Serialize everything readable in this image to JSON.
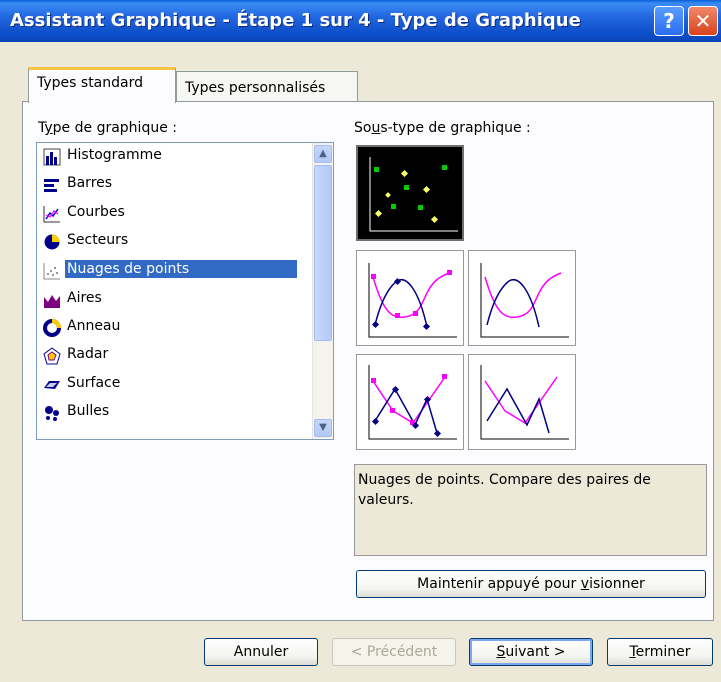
{
  "window": {
    "title": "Assistant Graphique - Étape 1 sur 4 - Type de Graphique",
    "help_label": "?",
    "close_label": "✕"
  },
  "tabs": [
    {
      "label": "Types standard",
      "active": true
    },
    {
      "label": "Types personnalisés",
      "active": false
    }
  ],
  "chart_type_list": {
    "label_prefix": "T",
    "label_accel": "y",
    "label_rest": "pe de graphique :",
    "items": [
      {
        "label": "Histogramme",
        "icon": "column-chart-icon"
      },
      {
        "label": "Barres",
        "icon": "bar-chart-icon"
      },
      {
        "label": "Courbes",
        "icon": "line-chart-icon"
      },
      {
        "label": "Secteurs",
        "icon": "pie-chart-icon"
      },
      {
        "label": "Nuages de points",
        "icon": "scatter-chart-icon",
        "selected": true
      },
      {
        "label": "Aires",
        "icon": "area-chart-icon"
      },
      {
        "label": "Anneau",
        "icon": "doughnut-chart-icon"
      },
      {
        "label": "Radar",
        "icon": "radar-chart-icon"
      },
      {
        "label": "Surface",
        "icon": "surface-chart-icon"
      },
      {
        "label": "Bulles",
        "icon": "bubble-chart-icon"
      }
    ],
    "scroll_up": "▲",
    "scroll_down": "▼"
  },
  "subtype": {
    "label_prefix": "So",
    "label_accel": "u",
    "label_rest": "s-type de graphique :",
    "thumbnails": [
      "scatter-markers-only",
      "scatter-smooth-lines-markers",
      "scatter-smooth-lines",
      "scatter-straight-lines-markers",
      "scatter-straight-lines"
    ]
  },
  "description": "Nuages de points. Compare des paires de valeurs.",
  "preview_button": {
    "prefix": "Maintenir appuyé pour ",
    "accel": "v",
    "rest": "isionner"
  },
  "buttons": {
    "cancel": "Annuler",
    "previous": "< Précédent",
    "next_accel": "S",
    "next_rest": "uivant >",
    "finish_accel": "T",
    "finish_rest": "erminer"
  },
  "colors": {
    "title_bar": "#0d4fc9",
    "selection": "#316ac5",
    "series_magenta": "#ff00ff",
    "series_navy": "#000080",
    "marker_green": "#00cc00",
    "marker_yellow": "#ffff66"
  }
}
